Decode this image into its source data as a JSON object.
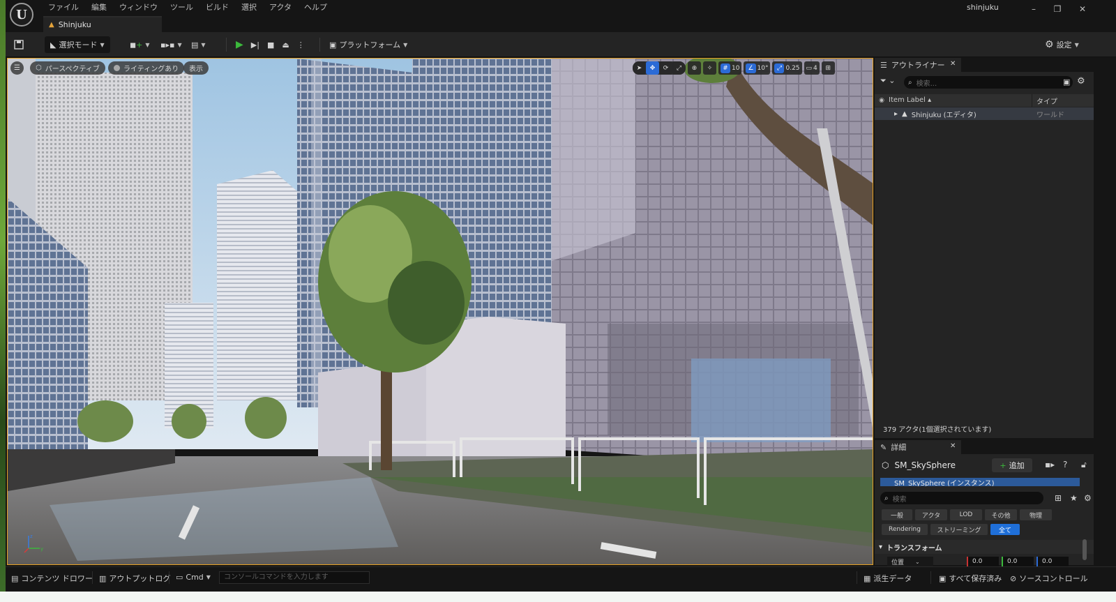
{
  "menu": [
    "ファイル",
    "編集",
    "ウィンドウ",
    "ツール",
    "ビルド",
    "選択",
    "アクタ",
    "ヘルプ"
  ],
  "window": {
    "project": "shinjuku",
    "minimize": "–",
    "restore": "❐",
    "close": "✕"
  },
  "level_tab": {
    "label": "Shinjuku"
  },
  "toolbar": {
    "select_mode": "選択モード",
    "platforms": "プラットフォーム",
    "settings": "設定"
  },
  "viewport": {
    "perspective": "パースペクティブ",
    "lighting": "ライティングあり",
    "show": "表示",
    "grid_snap": "10",
    "rotation_snap": "10°",
    "scale_snap": "0.25",
    "camera_speed": "4"
  },
  "outliner": {
    "tab": "アウトライナー",
    "search_placeholder": "検索...",
    "col_label": "Item Label ▴",
    "col_type": "タイプ",
    "rows": [
      {
        "label": "Shinjuku (エディタ)",
        "type": "ワールド"
      }
    ],
    "footer": "379 アクタ(1個選択されています)"
  },
  "details": {
    "tab": "詳細",
    "actor": "SM_SkySphere",
    "add": "追加",
    "component": "SM_SkySphere (インスタンス)",
    "search_placeholder": "検索",
    "filters_row1": [
      "一般",
      "アクタ",
      "LOD",
      "その他",
      "物理"
    ],
    "filters_row2": [
      "Rendering",
      "ストリーミング",
      "全て"
    ],
    "active_filter": "全て",
    "transform": "トランスフォーム",
    "location": "位置",
    "loc_x": "0.0",
    "loc_y": "0.0",
    "loc_z": "0.0"
  },
  "status": {
    "content_drawer": "コンテンツ ドロワー",
    "output_log": "アウトプットログ",
    "cmd": "Cmd",
    "console_placeholder": "コンソールコマンドを入力します",
    "derived_data": "派生データ",
    "save_all": "すべて保存済み",
    "source_control": "ソースコントロール"
  },
  "colors": {
    "accent": "#2c6bd6",
    "viewport_border": "#e6a123",
    "play": "#3cb93c"
  }
}
